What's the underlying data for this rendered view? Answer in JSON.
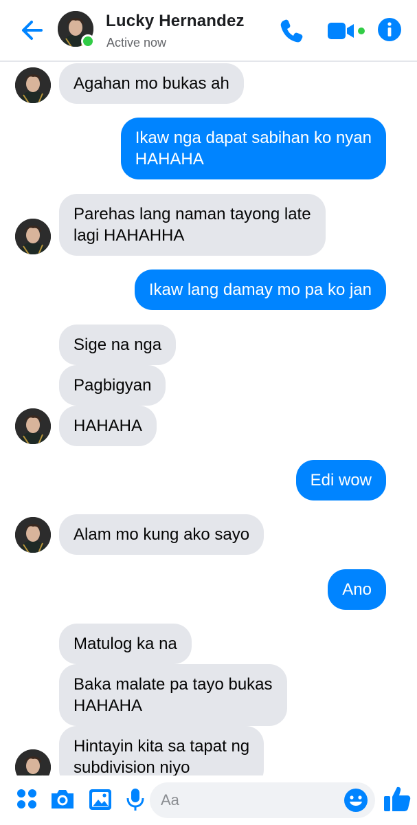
{
  "header": {
    "contact_name": "Lucky Hernandez",
    "status": "Active now",
    "icons": [
      "back-arrow-icon",
      "phone-icon",
      "video-camera-icon",
      "info-icon"
    ],
    "accent_color": "#0084ff",
    "online_color": "#31cc46"
  },
  "messages": [
    {
      "sender": "contact",
      "text": "Agahan mo bukas ah"
    },
    {
      "sender": "me",
      "lines": [
        "Ikaw nga dapat sabihan ko nyan",
        "HAHAHA"
      ]
    },
    {
      "sender": "contact",
      "lines": [
        "Parehas lang naman tayong late",
        "lagi HAHAHHA"
      ]
    },
    {
      "sender": "me",
      "text": "Ikaw lang damay mo pa ko jan"
    },
    {
      "sender": "contact",
      "text": "Sige na nga"
    },
    {
      "sender": "contact",
      "text": "Pagbigyan"
    },
    {
      "sender": "contact",
      "text": "HAHAHA"
    },
    {
      "sender": "me",
      "text": "Edi wow"
    },
    {
      "sender": "contact",
      "text": "Alam mo kung ako sayo"
    },
    {
      "sender": "me",
      "text": "Ano"
    },
    {
      "sender": "contact",
      "text": "Matulog ka na"
    },
    {
      "sender": "contact",
      "lines": [
        "Baka malate pa tayo bukas",
        "HAHAHA"
      ]
    },
    {
      "sender": "contact",
      "lines": [
        "Hintayin kita sa tapat ng",
        "subdivision niyo"
      ]
    }
  ],
  "colors": {
    "incoming_bubble": "#e4e6eb",
    "outgoing_bubble": "#0084ff"
  },
  "composer": {
    "placeholder": "Aa",
    "icons": [
      "menu-dots-icon",
      "camera-icon",
      "gallery-icon",
      "microphone-icon",
      "emoji-icon",
      "thumbs-up-icon"
    ]
  }
}
